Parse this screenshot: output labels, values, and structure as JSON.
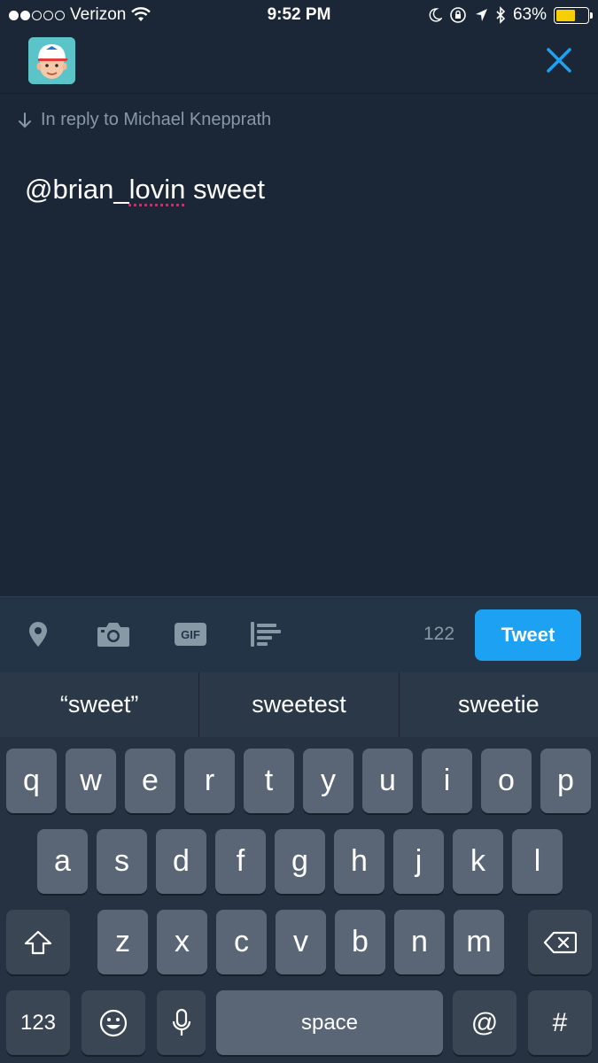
{
  "status_bar": {
    "carrier": "Verizon",
    "time": "9:52 PM",
    "battery": "63%",
    "battery_level": 0.63
  },
  "reply": {
    "context": "In reply to Michael Knepprath"
  },
  "compose": {
    "mention": "@brian_",
    "misspelled": "lovin",
    "rest": " sweet"
  },
  "toolbar": {
    "char_count": "122",
    "tweet_label": "Tweet",
    "icons": [
      "location-pin-icon",
      "camera-icon",
      "gif-icon",
      "poll-icon"
    ]
  },
  "suggestions": [
    "“sweet”",
    "sweetest",
    "sweetie"
  ],
  "keyboard": {
    "row1": [
      "q",
      "w",
      "e",
      "r",
      "t",
      "y",
      "u",
      "i",
      "o",
      "p"
    ],
    "row2": [
      "a",
      "s",
      "d",
      "f",
      "g",
      "h",
      "j",
      "k",
      "l"
    ],
    "row3": [
      "z",
      "x",
      "c",
      "v",
      "b",
      "n",
      "m"
    ],
    "numbers_key": "123",
    "space_key": "space",
    "at_key": "@",
    "hash_key": "#"
  },
  "colors": {
    "background": "#1b2736",
    "accent": "#1da1f2",
    "muted_text": "#8899a6",
    "battery": "#f7ce00"
  }
}
